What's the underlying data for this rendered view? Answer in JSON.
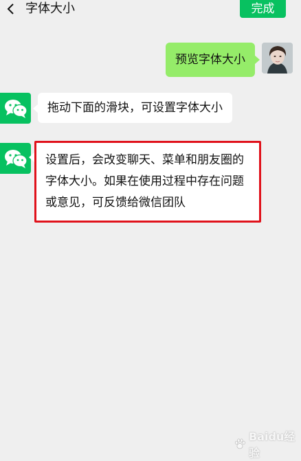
{
  "header": {
    "title": "字体大小",
    "done_label": "完成"
  },
  "messages": {
    "preview": "预览字体大小",
    "hint": "拖动下面的滑块，可设置字体大小",
    "info": "设置后，会改变聊天、菜单和朋友圈的字体大小。如果在使用过程中存在问题或意见，可反馈给微信团队"
  },
  "watermark": "Baidu经验",
  "colors": {
    "accent": "#07c160",
    "sent_bubble": "#95ec69",
    "highlight_border": "#e0121b",
    "background": "#efefef"
  },
  "icons": {
    "back": "chevron-left-icon",
    "wechat": "wechat-icon",
    "paw": "paw-icon"
  }
}
